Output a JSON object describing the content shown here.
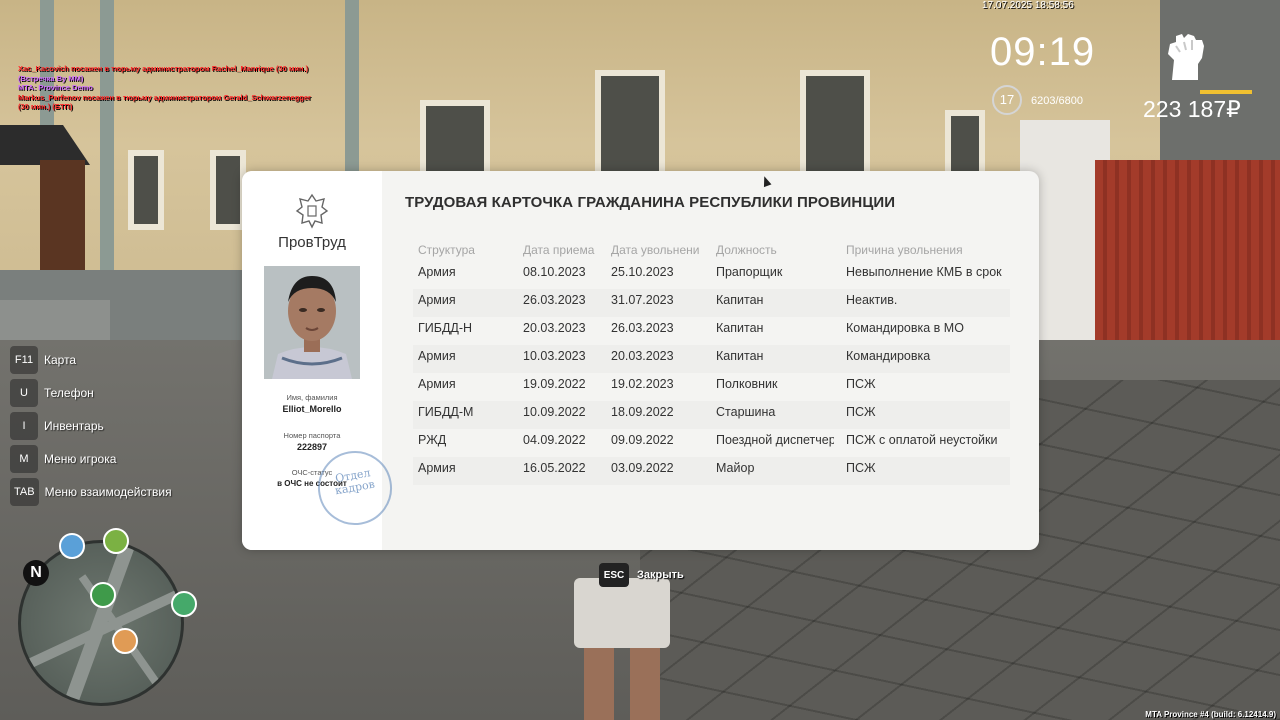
{
  "hud": {
    "datetime": "17.07.2025 18:58:56",
    "clock": "09:19",
    "level": "17",
    "xp": "6203/6800",
    "money": "223 187₽",
    "health_color": "#f0c030"
  },
  "chat": [
    {
      "text": "Xac_Kacovich посажен в тюрьму администратором Rachel_Manrique (30 мин.)",
      "color": "red"
    },
    {
      "text": "(Встречка By MM)",
      "color": "purple"
    },
    {
      "text": "MTA: Province Demo",
      "color": "purple"
    },
    {
      "text": "Markus_Parfenov посажен в тюрьму администратором Gerald_Schwarzenegger",
      "color": "red"
    },
    {
      "text": "(30 мин.) (БТП)",
      "color": "red"
    }
  ],
  "hints": [
    {
      "key": "F11",
      "label": "Карта"
    },
    {
      "key": "U",
      "label": "Телефон"
    },
    {
      "key": "I",
      "label": "Инвентарь"
    },
    {
      "key": "M",
      "label": "Меню игрока"
    },
    {
      "key": "TAB",
      "label": "Меню взаимодействия"
    }
  ],
  "minimap": {
    "north": "N"
  },
  "card": {
    "org_name": "ПровТруд",
    "title": "ТРУДОВАЯ КАРТОЧКА ГРАЖДАНИНА РЕСПУБЛИКИ ПРОВИНЦИИ",
    "name_label": "Имя, фамилия",
    "name_value": "Elliot_Morello",
    "passport_label": "Номер паспорта",
    "passport_value": "222897",
    "status_label": "ОЧС-статус",
    "status_value": "в ОЧС не состоит",
    "stamp_text": [
      "Отдел",
      "кадров"
    ],
    "columns": [
      "Структура",
      "Дата приема",
      "Дата увольнени",
      "Должность",
      "Причина увольнения"
    ],
    "rows": [
      [
        "Армия",
        "08.10.2023",
        "25.10.2023",
        "Прапорщик",
        "Невыполнение КМБ в срок"
      ],
      [
        "Армия",
        "26.03.2023",
        "31.07.2023",
        "Капитан",
        "Неактив."
      ],
      [
        "ГИБДД-Н",
        "20.03.2023",
        "26.03.2023",
        "Капитан",
        "Командировка в МО"
      ],
      [
        "Армия",
        "10.03.2023",
        "20.03.2023",
        "Капитан",
        "Командировка"
      ],
      [
        "Армия",
        "19.09.2022",
        "19.02.2023",
        "Полковник",
        "ПСЖ"
      ],
      [
        "ГИБДД-М",
        "10.09.2022",
        "18.09.2022",
        "Старшина",
        "ПСЖ"
      ],
      [
        "РЖД",
        "04.09.2022",
        "09.09.2022",
        "Поездной диспетчер",
        "ПСЖ с оплатой неустойки"
      ],
      [
        "Армия",
        "16.05.2022",
        "03.09.2022",
        "Майор",
        "ПСЖ"
      ]
    ]
  },
  "esc": {
    "key": "ESC",
    "label": "Закрыть"
  },
  "build": "MTA Province #4 (build: 6.12414.9)"
}
